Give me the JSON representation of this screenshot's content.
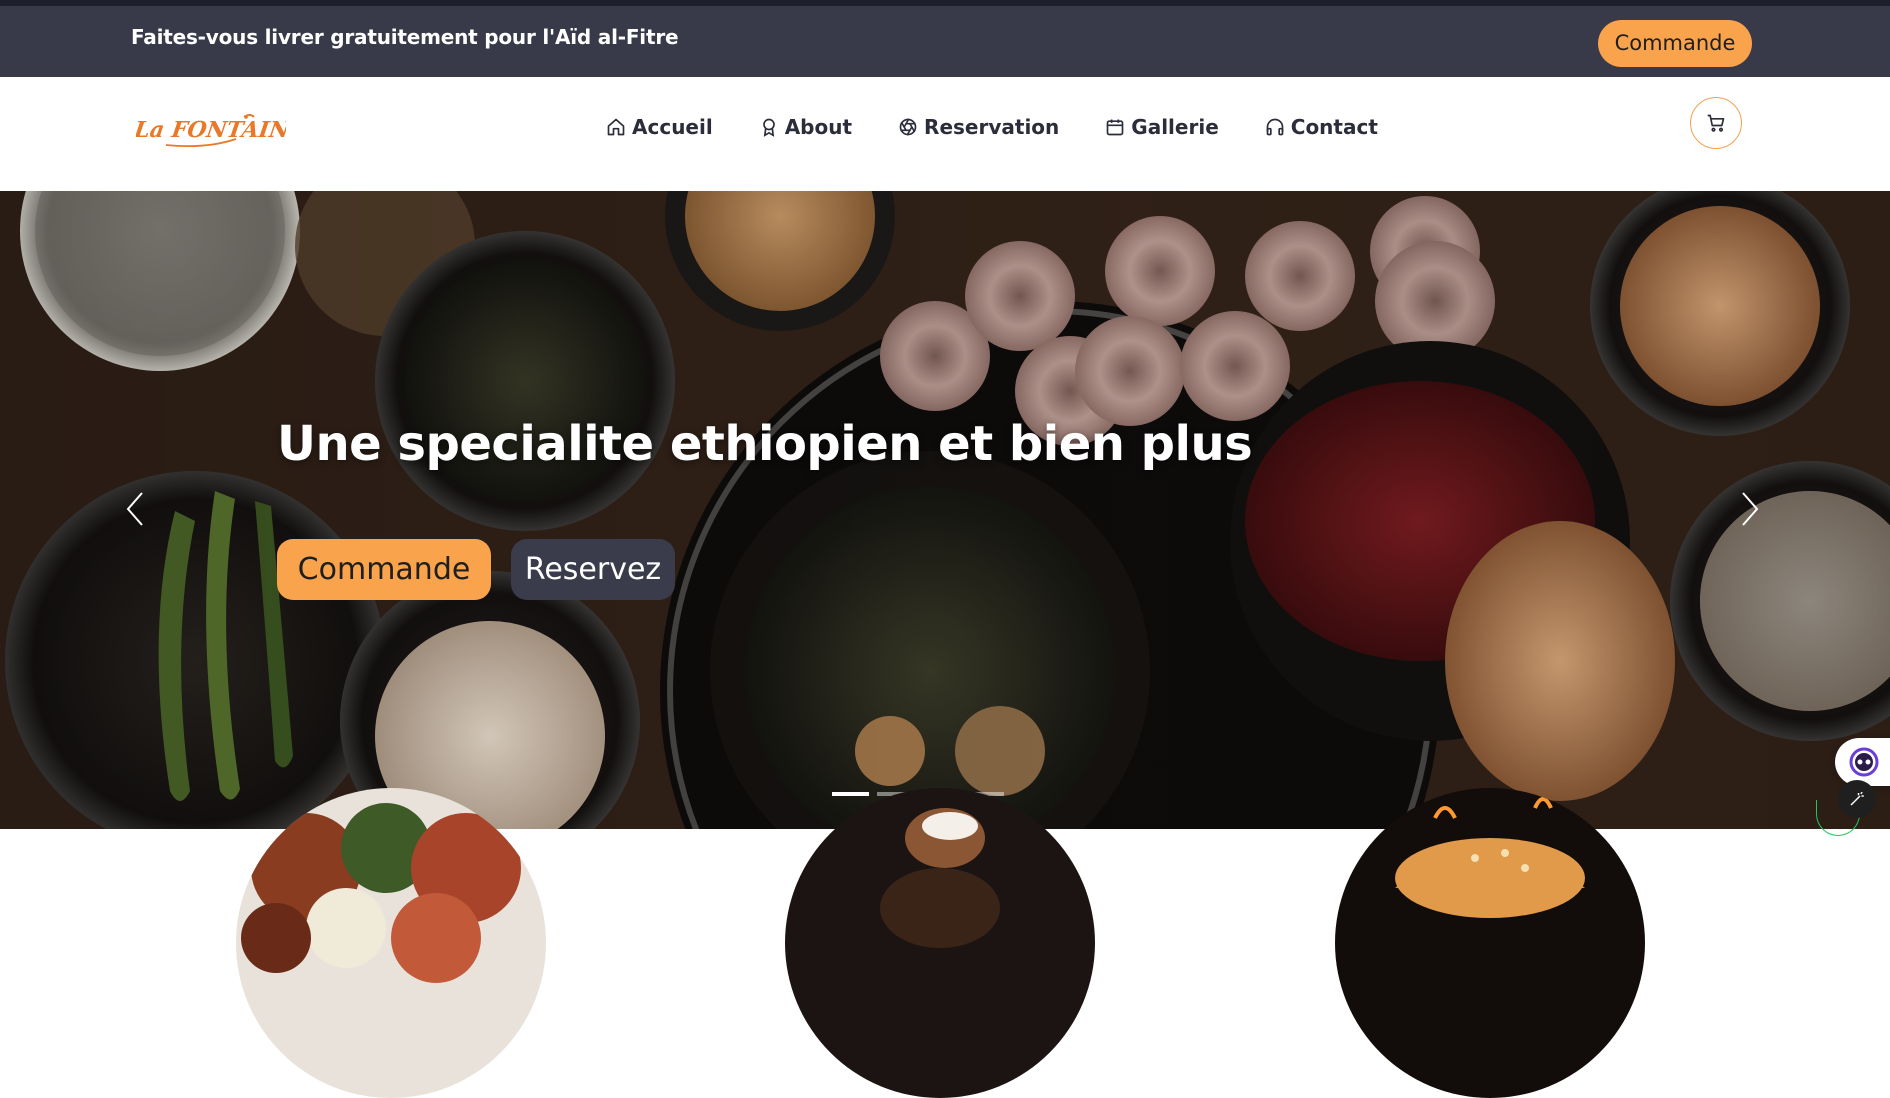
{
  "announcement": {
    "text": "Faites-vous livrer gratuitement pour l'Aïd al-Fitre",
    "button_label": "Commande"
  },
  "brand": {
    "logo_text": "La FONTAINE",
    "accent_color": "#f9a44d",
    "logo_color": "#e8782a"
  },
  "nav": {
    "items": [
      {
        "label": "Accueil",
        "icon": "home-icon"
      },
      {
        "label": "About",
        "icon": "award-icon"
      },
      {
        "label": "Reservation",
        "icon": "aperture-icon"
      },
      {
        "label": "Gallerie",
        "icon": "calendar-icon"
      },
      {
        "label": "Contact",
        "icon": "headphones-icon"
      }
    ],
    "cart_icon": "cart-icon"
  },
  "hero": {
    "title": "Une specialite ethiopien et bien plus",
    "order_button": "Commande",
    "reserve_button": "Reservez",
    "slide_count": 5,
    "active_slide": 1
  },
  "colors": {
    "announcement_bg": "#383a49",
    "secondary_button": "#3a3b4b"
  }
}
